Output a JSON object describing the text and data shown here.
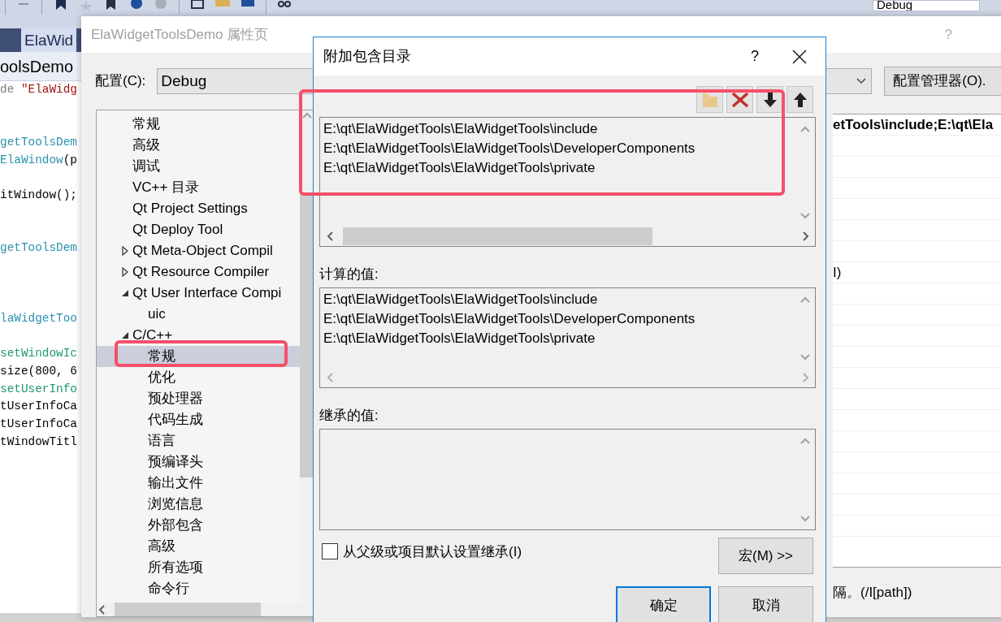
{
  "toolbar": {
    "config_value": "Debug"
  },
  "editor": {
    "tab": "ElaWid",
    "nav": "oolsDemo",
    "lines": [
      {
        "kind": "code",
        "spans": [
          {
            "text": "de ",
            "color": "#808080"
          },
          {
            "text": "\"ElaWidg",
            "color": "#a31515"
          }
        ]
      },
      {
        "kind": "blank"
      },
      {
        "kind": "blank"
      },
      {
        "kind": "code",
        "spans": [
          {
            "text": "getToolsDem",
            "color": "#2b91af"
          }
        ]
      },
      {
        "kind": "code",
        "spans": [
          {
            "text": "ElaWindow",
            "color": "#2b91af"
          },
          {
            "text": "(p",
            "color": "#000000"
          }
        ]
      },
      {
        "kind": "blank"
      },
      {
        "kind": "code",
        "spans": [
          {
            "text": "itWindow();",
            "color": "#000000"
          }
        ]
      },
      {
        "kind": "blank"
      },
      {
        "kind": "blank"
      },
      {
        "kind": "code",
        "spans": [
          {
            "text": "getToolsDem",
            "color": "#2b91af"
          }
        ]
      },
      {
        "kind": "blank"
      },
      {
        "kind": "blank"
      },
      {
        "kind": "blank"
      },
      {
        "kind": "code",
        "spans": [
          {
            "text": "laWidgetToo",
            "color": "#2b91af"
          }
        ]
      },
      {
        "kind": "blank"
      },
      {
        "kind": "code",
        "spans": [
          {
            "text": "setWindowIc",
            "color": "#1f9a6a"
          }
        ]
      },
      {
        "kind": "code",
        "spans": [
          {
            "text": "size(800, 6",
            "color": "#000000"
          }
        ]
      },
      {
        "kind": "code",
        "spans": [
          {
            "text": "setUserInfo",
            "color": "#1f9a6a"
          }
        ]
      },
      {
        "kind": "code",
        "spans": [
          {
            "text": "tUserInfoCa",
            "color": "#000000"
          }
        ]
      },
      {
        "kind": "code",
        "spans": [
          {
            "text": "tUserInfoCa",
            "color": "#000000"
          }
        ]
      },
      {
        "kind": "code",
        "spans": [
          {
            "text": "tWindowTitl",
            "color": "#000000"
          }
        ]
      }
    ]
  },
  "property_window": {
    "title": "ElaWidgetToolsDemo 属性页",
    "help": "?",
    "config_label": "配置(C):",
    "config_value": "Debug",
    "config_manager": "配置管理器(O).",
    "tree": [
      {
        "label": "常规",
        "selected": false
      },
      {
        "label": "高级",
        "selected": false
      },
      {
        "label": "调试",
        "selected": false
      },
      {
        "label": "VC++ 目录",
        "selected": false
      },
      {
        "label": "Qt Project Settings",
        "selected": false
      },
      {
        "label": "Qt Deploy Tool",
        "selected": false
      },
      {
        "label": "Qt Meta-Object Compil",
        "selected": false,
        "expanded": false
      },
      {
        "label": "Qt Resource Compiler",
        "selected": false,
        "expanded": false
      },
      {
        "label": "Qt User Interface Compi",
        "selected": false,
        "expanded": true,
        "children": [
          {
            "label": "uic",
            "selected": false
          }
        ]
      },
      {
        "label": "C/C++",
        "selected": false,
        "expanded": true,
        "children": [
          {
            "label": "常规",
            "selected": true
          },
          {
            "label": "优化",
            "selected": false
          },
          {
            "label": "预处理器",
            "selected": false
          },
          {
            "label": "代码生成",
            "selected": false
          },
          {
            "label": "语言",
            "selected": false
          },
          {
            "label": "预编译头",
            "selected": false
          },
          {
            "label": "输出文件",
            "selected": false
          },
          {
            "label": "浏览信息",
            "selected": false
          },
          {
            "label": "外部包含",
            "selected": false
          },
          {
            "label": "高级",
            "selected": false
          },
          {
            "label": "所有选项",
            "selected": false
          },
          {
            "label": "命令行",
            "selected": false
          }
        ]
      }
    ],
    "grid_rows": [
      {
        "kind": "value",
        "text": "etTools\\include;E:\\qt\\Ela",
        "bold": true
      },
      {
        "kind": "blank"
      },
      {
        "kind": "blank"
      },
      {
        "kind": "blank"
      },
      {
        "kind": "blank"
      },
      {
        "kind": "blank"
      },
      {
        "kind": "blank"
      },
      {
        "kind": "value",
        "text": "I)",
        "bold": false
      },
      {
        "kind": "blank"
      },
      {
        "kind": "blank"
      },
      {
        "kind": "blank"
      },
      {
        "kind": "blank"
      },
      {
        "kind": "blank"
      },
      {
        "kind": "blank"
      },
      {
        "kind": "blank"
      },
      {
        "kind": "blank"
      },
      {
        "kind": "blank"
      },
      {
        "kind": "blank"
      },
      {
        "kind": "blank"
      },
      {
        "kind": "blank"
      }
    ],
    "description": "隔。(/I[path])"
  },
  "dialog": {
    "title": "附加包含目录",
    "help": "?",
    "tools": [
      {
        "kind": "new-folder"
      },
      {
        "kind": "delete"
      },
      {
        "kind": "move-down"
      },
      {
        "kind": "move-up"
      }
    ],
    "entries": [
      "E:\\qt\\ElaWidgetTools\\ElaWidgetTools\\include",
      "E:\\qt\\ElaWidgetTools\\ElaWidgetTools\\DeveloperComponents",
      "E:\\qt\\ElaWidgetTools\\ElaWidgetTools\\private"
    ],
    "computed_label": "计算的值:",
    "computed": [
      "E:\\qt\\ElaWidgetTools\\ElaWidgetTools\\include",
      "E:\\qt\\ElaWidgetTools\\ElaWidgetTools\\DeveloperComponents",
      "E:\\qt\\ElaWidgetTools\\ElaWidgetTools\\private"
    ],
    "inherited_label": "继承的值:",
    "inherit_checkbox": {
      "label": "从父级或项目默认设置继承(I)",
      "checked": false
    },
    "macro_button": "宏(M) >>",
    "ok": "确定",
    "cancel": "取消"
  }
}
